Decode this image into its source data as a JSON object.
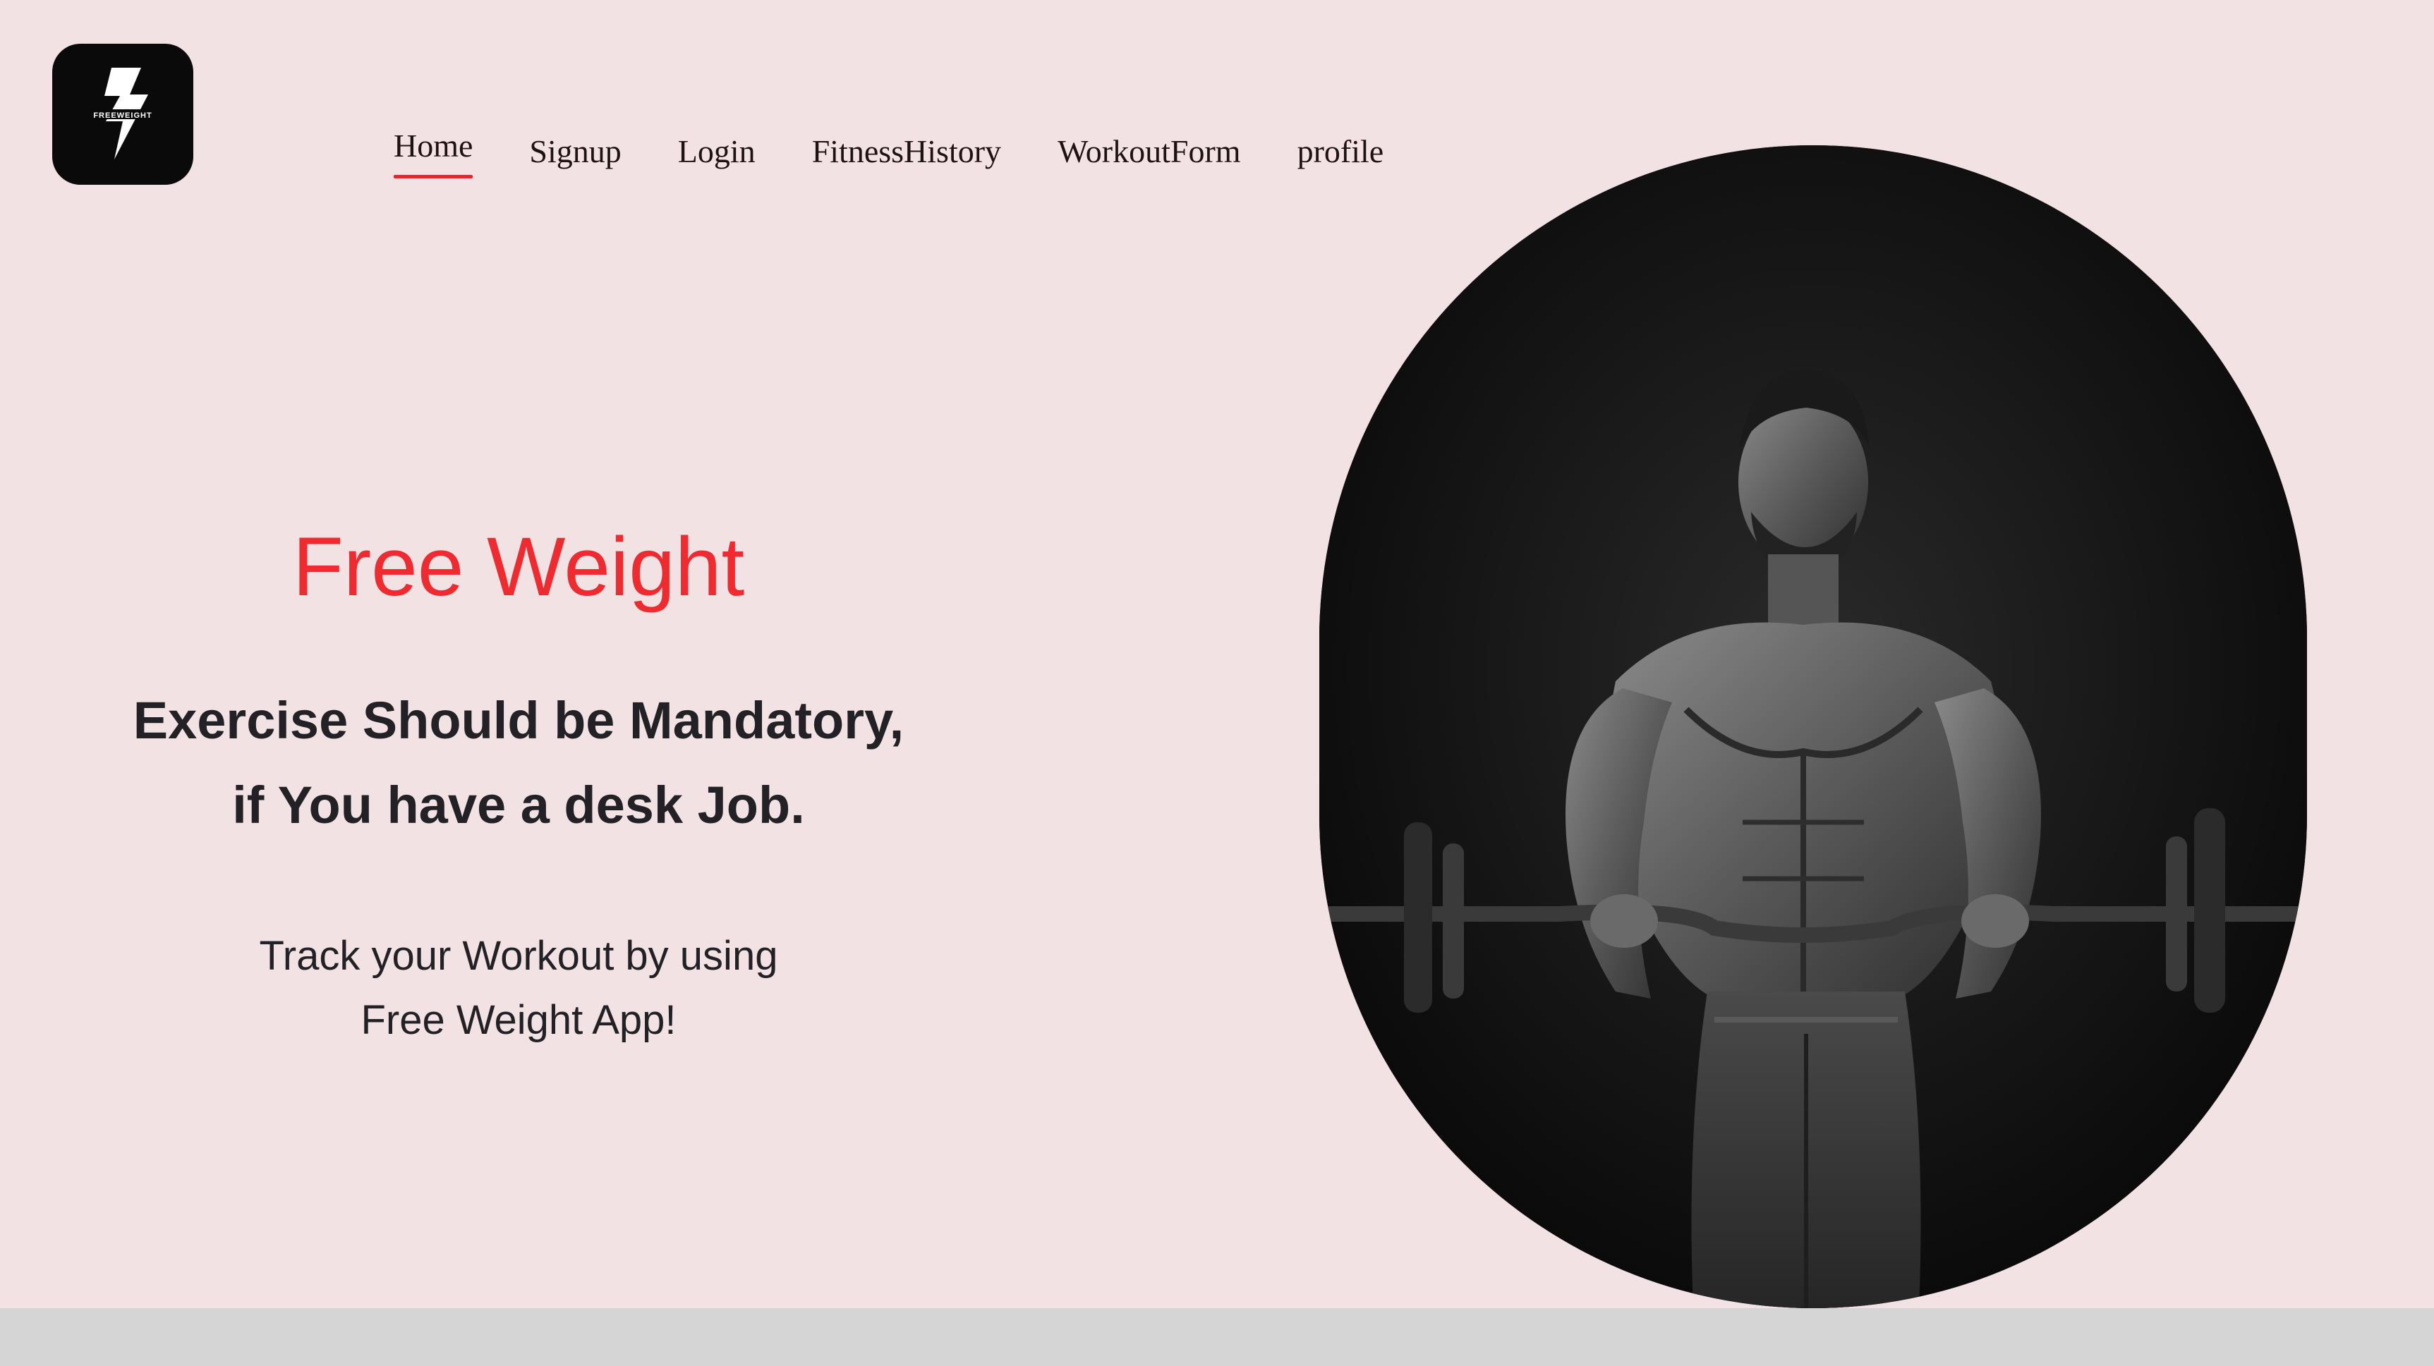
{
  "logo": {
    "text": "FREEWEIGHT",
    "icon": "lightning-bolt-icon"
  },
  "nav": {
    "items": [
      {
        "label": "Home",
        "active": true
      },
      {
        "label": "Signup",
        "active": false
      },
      {
        "label": "Login",
        "active": false
      },
      {
        "label": "FitnessHistory",
        "active": false
      },
      {
        "label": "WorkoutForm",
        "active": false
      },
      {
        "label": "profile",
        "active": false
      }
    ]
  },
  "hero": {
    "title": "Free Weight",
    "subtitle_line1": "Exercise Should be Mandatory,",
    "subtitle_line2": "if You have a desk Job.",
    "desc_line1": "Track your Workout by using",
    "desc_line2": "Free Weight App!",
    "image": "man-lifting-barbell-photo"
  },
  "colors": {
    "background": "#f2e2e4",
    "accent": "#ef2b2f",
    "text": "#222226",
    "footer": "#d5d5d5"
  }
}
